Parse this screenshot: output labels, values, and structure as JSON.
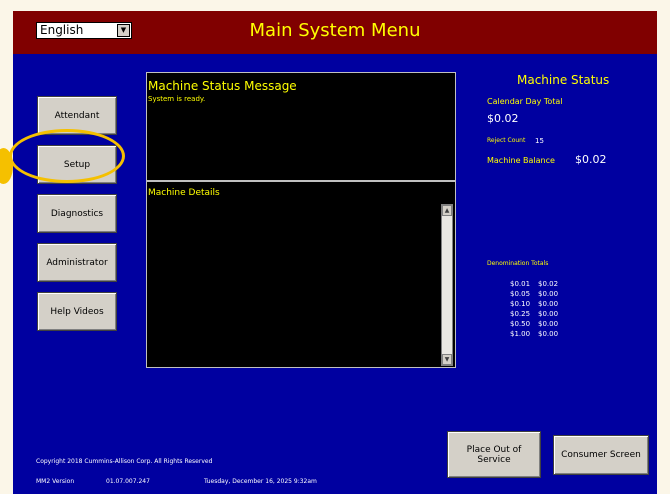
{
  "header": {
    "title": "Main System Menu",
    "language": "English"
  },
  "nav": {
    "attendant": "Attendant",
    "setup": "Setup",
    "diagnostics": "Diagnostics",
    "administrator": "Administrator",
    "help_videos": "Help Videos"
  },
  "status_panel": {
    "title": "Machine Status Message",
    "message": "System is ready."
  },
  "details_panel": {
    "title": "Machine Details"
  },
  "machine_status": {
    "title": "Machine Status",
    "calendar_label": "Calendar Day Total",
    "calendar_value": "$0.02",
    "reject_label": "Reject Count",
    "reject_value": "15",
    "balance_label": "Machine Balance",
    "balance_value": "$0.02",
    "denom_title": "Denomination Totals",
    "denoms": [
      {
        "denom": "$0.01",
        "total": "$0.02"
      },
      {
        "denom": "$0.05",
        "total": "$0.00"
      },
      {
        "denom": "$0.10",
        "total": "$0.00"
      },
      {
        "denom": "$0.25",
        "total": "$0.00"
      },
      {
        "denom": "$0.50",
        "total": "$0.00"
      },
      {
        "denom": "$1.00",
        "total": "$0.00"
      }
    ]
  },
  "footer": {
    "copyright": "Copyright 2018 Cummins-Allison Corp. All Rights Reserved",
    "version_label": "MM2 Version",
    "version_value": "01.07.007.247",
    "datetime": "Tuesday, December 16, 2025 9:32am"
  },
  "actions": {
    "out_of_service": "Place Out of Service",
    "consumer_screen": "Consumer Screen"
  },
  "colors": {
    "background": "#0000a0",
    "titlebar": "#800000",
    "accent_text": "#ffff00",
    "highlight": "#f5c000"
  }
}
